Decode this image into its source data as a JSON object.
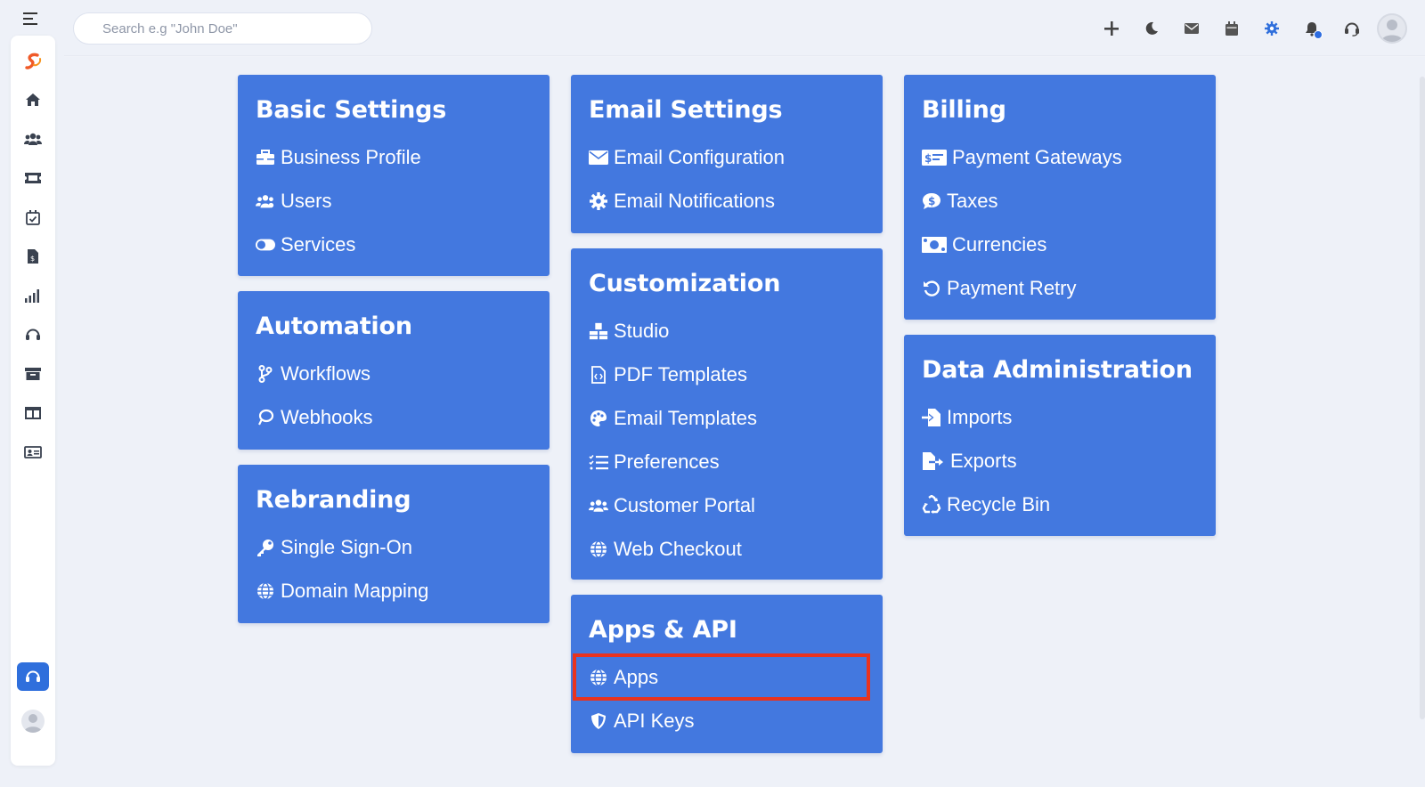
{
  "search": {
    "placeholder": "Search e.g \"John Doe\""
  },
  "top_actions": [
    "plus-icon",
    "moon-icon",
    "mail-icon",
    "calendar-icon",
    "gear-icon",
    "bell-icon",
    "headset-icon",
    "avatar"
  ],
  "sidebar": [
    "logo-icon",
    "home-icon",
    "users-icon",
    "ticket-icon",
    "calendar-check-icon",
    "invoice-icon",
    "signal-icon",
    "headset-icon",
    "archive-icon",
    "columns-icon",
    "id-card-icon",
    "support-button",
    "avatar"
  ],
  "cards": {
    "basic_settings": {
      "title": "Basic Settings",
      "items": [
        "Business Profile",
        "Users",
        "Services"
      ]
    },
    "automation": {
      "title": "Automation",
      "items": [
        "Workflows",
        "Webhooks"
      ]
    },
    "rebranding": {
      "title": "Rebranding",
      "items": [
        "Single Sign-On",
        "Domain Mapping"
      ]
    },
    "email_settings": {
      "title": "Email Settings",
      "items": [
        "Email Configuration",
        "Email Notifications"
      ]
    },
    "customization": {
      "title": "Customization",
      "items": [
        "Studio",
        "PDF Templates",
        "Email Templates",
        "Preferences",
        "Customer Portal",
        "Web Checkout"
      ]
    },
    "apps_api": {
      "title": "Apps & API",
      "items": [
        "Apps",
        "API Keys"
      ]
    },
    "billing": {
      "title": "Billing",
      "items": [
        "Payment Gateways",
        "Taxes",
        "Currencies",
        "Payment Retry"
      ]
    },
    "data_administration": {
      "title": "Data Administration",
      "items": [
        "Imports",
        "Exports",
        "Recycle Bin"
      ]
    }
  },
  "colors": {
    "card_bg": "#4378df",
    "page_bg": "#eef1f8",
    "highlight": "#e8331f",
    "accent": "#2f6fdc",
    "logo": "#f05a28"
  }
}
